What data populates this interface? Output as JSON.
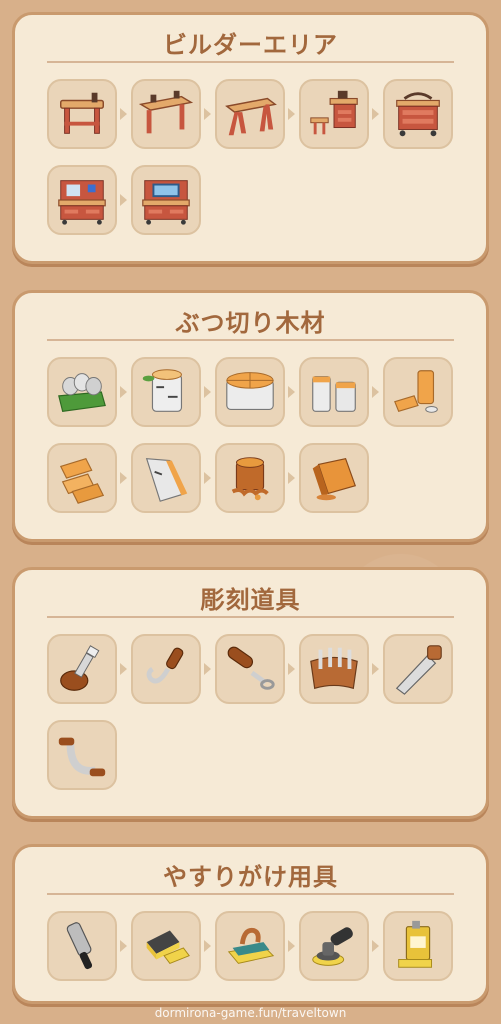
{
  "sections": [
    {
      "title": "ビルダーエリア",
      "items": [
        {
          "icon": "small-workbench-icon"
        },
        {
          "icon": "long-workbench-icon"
        },
        {
          "icon": "sawhorse-bench-icon"
        },
        {
          "icon": "workbench-with-stool-icon"
        },
        {
          "icon": "tool-cart-icon"
        },
        {
          "icon": "desk-with-clamps-icon"
        },
        {
          "icon": "desk-with-monitor-icon"
        }
      ]
    },
    {
      "title": "ぶつ切り木材",
      "items": [
        {
          "icon": "log-pile-crate-icon"
        },
        {
          "icon": "birch-log-icon"
        },
        {
          "icon": "log-round-icon"
        },
        {
          "icon": "split-logs-icon"
        },
        {
          "icon": "chopped-wood-chunks-icon"
        },
        {
          "icon": "wood-planks-icon"
        },
        {
          "icon": "bark-slab-icon"
        },
        {
          "icon": "tree-stump-icon"
        },
        {
          "icon": "wood-block-icon"
        }
      ]
    },
    {
      "title": "彫刻道具",
      "items": [
        {
          "icon": "flat-chisel-icon"
        },
        {
          "icon": "hook-knife-icon"
        },
        {
          "icon": "gouge-tool-icon"
        },
        {
          "icon": "tool-roll-icon"
        },
        {
          "icon": "hand-saw-icon"
        },
        {
          "icon": "drawknife-icon"
        }
      ]
    },
    {
      "title": "やすりがけ用具",
      "items": [
        {
          "icon": "rasp-file-icon"
        },
        {
          "icon": "sanding-sponge-icon"
        },
        {
          "icon": "sanding-block-icon"
        },
        {
          "icon": "orbital-sander-icon"
        },
        {
          "icon": "varnish-can-icon"
        }
      ]
    }
  ],
  "watermark": "dormirona-game.fun/traveltown"
}
